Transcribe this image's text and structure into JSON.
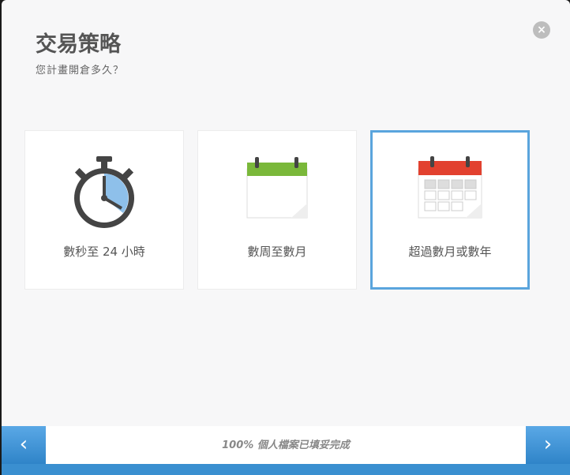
{
  "header": {
    "title": "交易策略",
    "subtitle": "您計畫開倉多久？",
    "close": "×"
  },
  "options": [
    {
      "label": "數秒至 24 小時",
      "icon": "stopwatch-icon",
      "selected": false
    },
    {
      "label": "數周至數月",
      "icon": "calendar-blank-icon",
      "selected": false
    },
    {
      "label": "超過數月或數年",
      "icon": "calendar-grid-icon",
      "selected": true
    }
  ],
  "footer": {
    "prev": "‹",
    "next": "›",
    "progress": "100% 個人檔案已填妥完成"
  },
  "colors": {
    "accent": "#3a8fd0",
    "selected_border": "#5aa5dd",
    "green": "#7ab83a",
    "red": "#e2412f"
  }
}
